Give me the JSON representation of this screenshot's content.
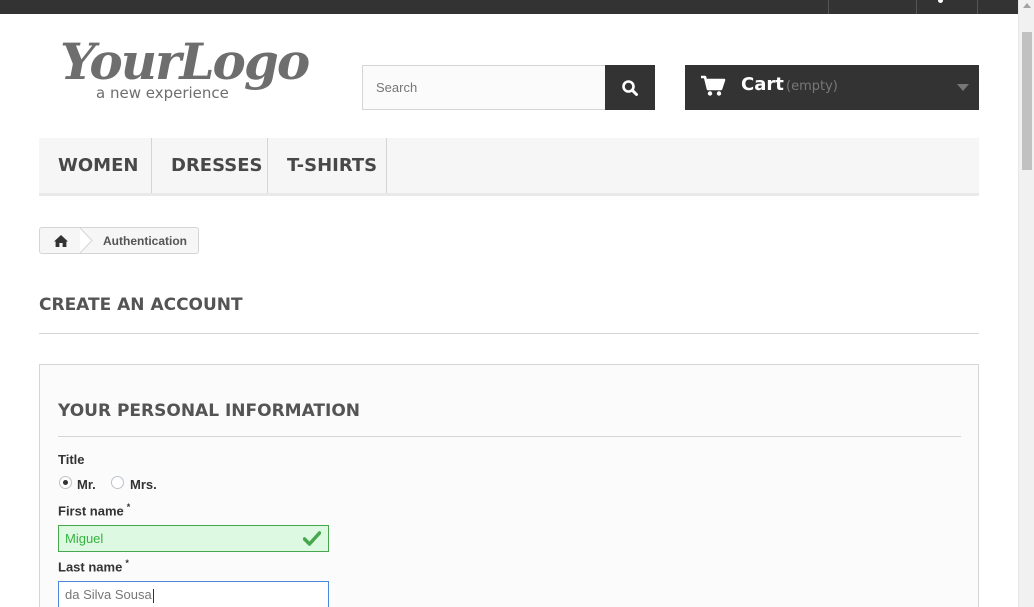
{
  "logo": {
    "text": "YourLogo",
    "tagline": "a new experience"
  },
  "search": {
    "placeholder": "Search"
  },
  "cart": {
    "label": "Cart",
    "status": "(empty)"
  },
  "menu": {
    "items": [
      "Women",
      "Dresses",
      "T-shirts"
    ]
  },
  "breadcrumb": {
    "current": "Authentication"
  },
  "page": {
    "title": "Create an account"
  },
  "form": {
    "section_title": "Your personal information",
    "title_label": "Title",
    "title_options": [
      "Mr.",
      "Mrs."
    ],
    "title_selected": "Mr.",
    "first_name_label": "First name",
    "first_name_value": "Miguel",
    "last_name_label": "Last name",
    "last_name_value": "da Silva Sousa",
    "required_mark": "*"
  },
  "colors": {
    "dark": "#333333",
    "valid": "#46a74e",
    "focus": "#4a89dc"
  }
}
